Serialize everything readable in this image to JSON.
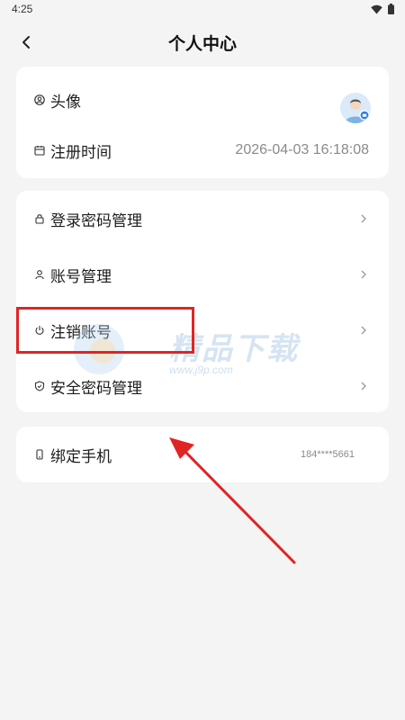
{
  "status_bar": {
    "time": "4:25"
  },
  "nav": {
    "title": "个人中心"
  },
  "profile_card": {
    "avatar_label": "头像",
    "register_label": "注册时间",
    "register_value": "2026-04-03 16:18:08"
  },
  "security_card": {
    "items": [
      {
        "label": "登录密码管理",
        "icon": "lock-icon"
      },
      {
        "label": "账号管理",
        "icon": "person-icon"
      },
      {
        "label": "注销账号",
        "icon": "power-icon"
      },
      {
        "label": "安全密码管理",
        "icon": "shield-icon"
      }
    ]
  },
  "phone_card": {
    "label": "绑定手机",
    "value": "184****5661",
    "icon": "phone-icon"
  },
  "watermark": {
    "title": "精品下载",
    "url": "www.j9p.com"
  },
  "annotation": {
    "highlight_color": "#e02424",
    "arrow_color": "#e02424"
  }
}
